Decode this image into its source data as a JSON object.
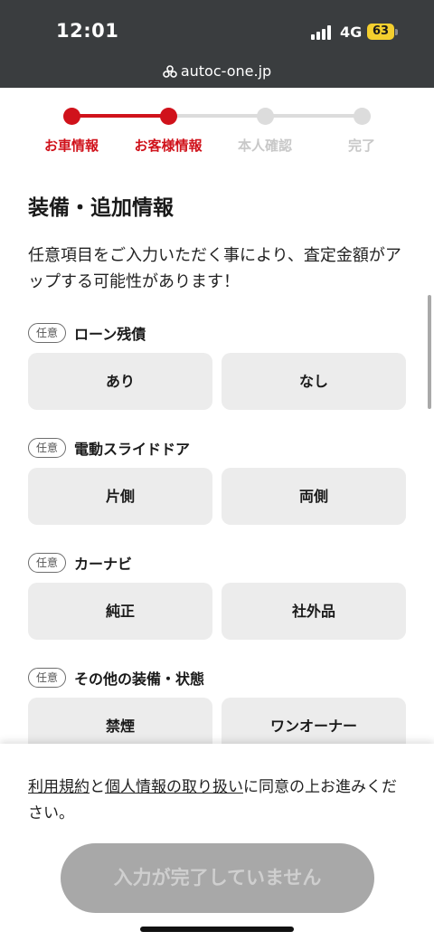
{
  "status_bar": {
    "time": "12:01",
    "network": "4G",
    "battery": "63"
  },
  "browser": {
    "url": "autoc-one.jp"
  },
  "steps": [
    {
      "label": "お車情報",
      "state": "done"
    },
    {
      "label": "お客様情報",
      "state": "current"
    },
    {
      "label": "本人確認",
      "state": "todo"
    },
    {
      "label": "完了",
      "state": "todo"
    }
  ],
  "colors": {
    "accent": "#d0121b",
    "inactive": "#dcdcdc",
    "inactive_text": "#c8c8c8"
  },
  "page": {
    "heading": "装備・追加情報",
    "intro": "任意項目をご入力いただく事により、査定金額がアップする可能性があります！"
  },
  "sections": [
    {
      "tag": "任意",
      "title": "ローン残債",
      "options": [
        "あり",
        "なし"
      ]
    },
    {
      "tag": "任意",
      "title": "電動スライドドア",
      "options": [
        "片側",
        "両側"
      ]
    },
    {
      "tag": "任意",
      "title": "カーナビ",
      "options": [
        "純正",
        "社外品"
      ]
    },
    {
      "tag": "任意",
      "title": "その他の装備・状態",
      "options": [
        "禁煙",
        "ワンオーナー"
      ]
    }
  ],
  "footer": {
    "terms_link": "利用規約",
    "and": "と",
    "privacy_link": "個人情報の取り扱い",
    "consent_rest": "に同意の上お進みください。",
    "submit_label": "入力が完了していません"
  }
}
